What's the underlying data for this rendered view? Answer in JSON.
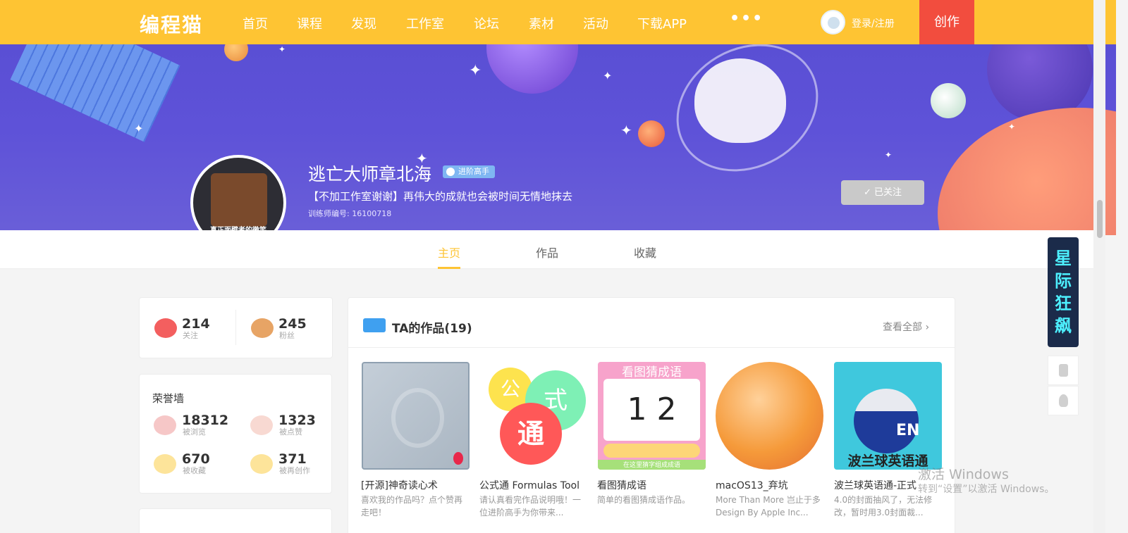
{
  "header": {
    "logo": "编程猫",
    "nav": [
      "首页",
      "课程",
      "发现",
      "工作室",
      "论坛",
      "素材",
      "活动",
      "下载APP"
    ],
    "more": "•••",
    "login": "登录/注册",
    "create": "创作"
  },
  "profile": {
    "avatar_caption": "真正面壁者的微笑",
    "name": "逃亡大师章北海",
    "badge": "进阶高手",
    "bio": "【不加工作室谢谢】再伟大的成就也会被时间无情地抹去",
    "trainer_id": "训练师编号: 16100718",
    "follow_label": "✓ 已关注"
  },
  "tabs": [
    "主页",
    "作品",
    "收藏"
  ],
  "social": {
    "following": {
      "num": "214",
      "label": "关注"
    },
    "fans": {
      "num": "245",
      "label": "粉丝"
    }
  },
  "honor": {
    "title": "荣誉墙",
    "views": {
      "num": "18312",
      "label": "被浏览"
    },
    "likes": {
      "num": "1323",
      "label": "被点赞"
    },
    "collects": {
      "num": "670",
      "label": "被收藏"
    },
    "remixes": {
      "num": "371",
      "label": "被再创作"
    }
  },
  "works": {
    "title": "TA的作品(19)",
    "view_all": "查看全部 ›",
    "items": [
      {
        "title": "[开源]神奇读心术",
        "desc": "喜欢我的作品吗？点个赞再走吧！"
      },
      {
        "title": "公式通 Formulas Tool",
        "desc": "请认真看完作品说明哦！一位进阶高手为你带来..."
      },
      {
        "title": "看图猜成语",
        "desc": "简单的看图猜成语作品。"
      },
      {
        "title": "macOS13_弃坑",
        "desc": "More Than More 岂止于多 Design By Apple Inc..."
      },
      {
        "title": "波兰球英语通-正式",
        "desc": "4.0的封面抽风了，无法修改，暂时用3.0封面裁..."
      }
    ],
    "thumb2_chars": [
      "公",
      "式",
      "通"
    ],
    "thumb3_title": "看图猜成语",
    "thumb3_text": "1 2",
    "thumb3_sub": "在这里猜字组成成语",
    "thumb5_en": "EN",
    "thumb5_text": "波兰球英语通"
  },
  "promo": "星际狂飙",
  "watermark": {
    "line1": "激活 Windows",
    "line2": "转到“设置”以激活 Windows。"
  }
}
